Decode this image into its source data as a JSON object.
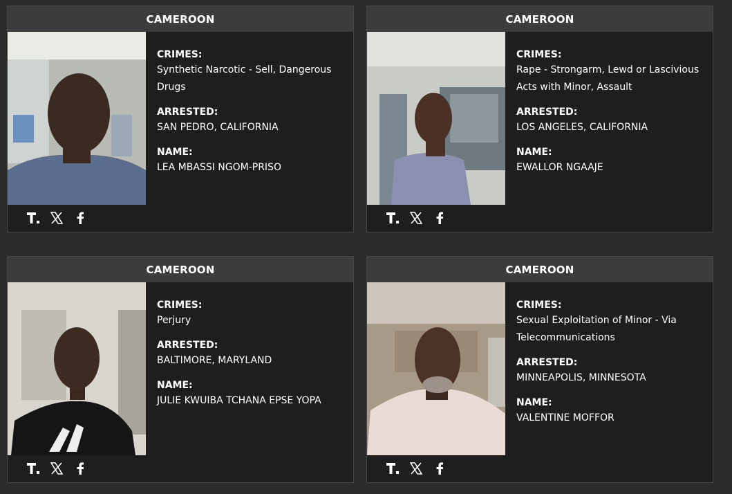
{
  "cards": [
    {
      "country": "CAMEROON",
      "crimes_label": "CRIMES:",
      "crimes": "Synthetic Narcotic - Sell, Dangerous Drugs",
      "arrested_label": "ARRESTED:",
      "arrested": "SAN PEDRO, CALIFORNIA",
      "name_label": "NAME:",
      "name": "LEA MBASSI NGOM-PRISO"
    },
    {
      "country": "CAMEROON",
      "crimes_label": "CRIMES:",
      "crimes": "Rape - Strongarm, Lewd or Lascivious Acts with Minor, Assault",
      "arrested_label": "ARRESTED:",
      "arrested": "LOS ANGELES, CALIFORNIA",
      "name_label": "NAME:",
      "name": "EWALLOR NGAAJE"
    },
    {
      "country": "CAMEROON",
      "crimes_label": "CRIMES:",
      "crimes": "Perjury",
      "arrested_label": "ARRESTED:",
      "arrested": "BALTIMORE, MARYLAND",
      "name_label": "NAME:",
      "name": "JULIE KWUIBA TCHANA EPSE YOPA"
    },
    {
      "country": "CAMEROON",
      "crimes_label": "CRIMES:",
      "crimes": "Sexual Exploitation of Minor - Via Telecommunications",
      "arrested_label": "ARRESTED:",
      "arrested": "MINNEAPOLIS, MINNESOTA",
      "name_label": "NAME:",
      "name": "VALENTINE MOFFOR"
    }
  ],
  "share_icons": [
    "truth-social-icon",
    "x-icon",
    "facebook-icon"
  ],
  "colors": {
    "page_background": "#2b2b2b",
    "card_background": "#1e1e1e",
    "header_background": "#3c3c3c",
    "text": "#ffffff"
  }
}
